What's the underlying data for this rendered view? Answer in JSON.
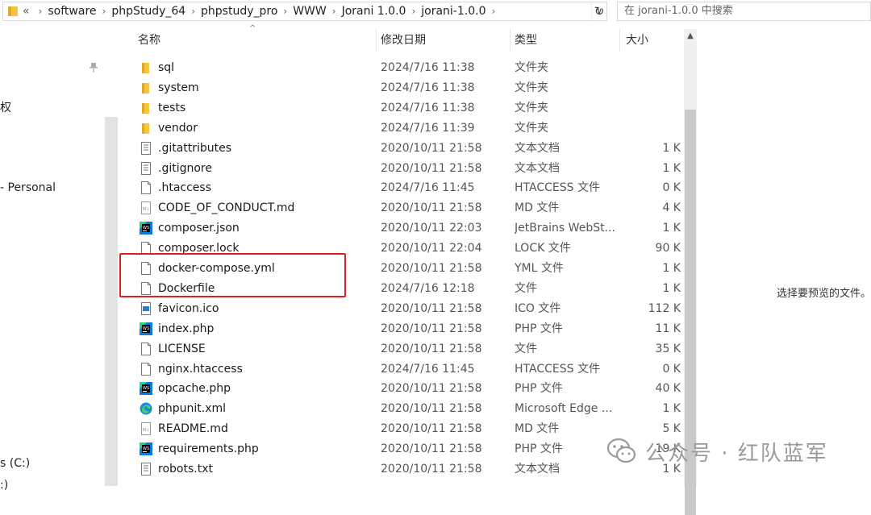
{
  "address": {
    "prefix": "«",
    "crumbs": [
      "software",
      "phpStudy_64",
      "phpstudy_pro",
      "WWW",
      "Jorani 1.0.0",
      "jorani-1.0.0"
    ],
    "separator": "›",
    "dropdown": "∨",
    "refresh": "↻"
  },
  "search": {
    "placeholder": "在 jorani-1.0.0 中搜索"
  },
  "nav": {
    "items": [
      {
        "label": "权"
      },
      {
        "label": "- Personal"
      },
      {
        "label": "s (C:)"
      },
      {
        "label": ":)"
      }
    ],
    "pin": "📌"
  },
  "columns": {
    "name": "名称",
    "date": "修改日期",
    "type": "类型",
    "size": "大小",
    "sort": "^"
  },
  "files": [
    {
      "name": "sql",
      "date": "2024/7/16 11:38",
      "type": "文件夹",
      "size": "",
      "icon": "folder-icon"
    },
    {
      "name": "system",
      "date": "2024/7/16 11:38",
      "type": "文件夹",
      "size": "",
      "icon": "folder-icon"
    },
    {
      "name": "tests",
      "date": "2024/7/16 11:38",
      "type": "文件夹",
      "size": "",
      "icon": "folder-icon"
    },
    {
      "name": "vendor",
      "date": "2024/7/16 11:39",
      "type": "文件夹",
      "size": "",
      "icon": "folder-icon"
    },
    {
      "name": ".gitattributes",
      "date": "2020/10/11 21:58",
      "type": "文本文档",
      "size": "1 K",
      "icon": "text-file-icon"
    },
    {
      "name": ".gitignore",
      "date": "2020/10/11 21:58",
      "type": "文本文档",
      "size": "1 K",
      "icon": "text-file-icon"
    },
    {
      "name": ".htaccess",
      "date": "2024/7/16 11:45",
      "type": "HTACCESS 文件",
      "size": "0 K",
      "icon": "blank-file-icon"
    },
    {
      "name": "CODE_OF_CONDUCT.md",
      "date": "2020/10/11 21:58",
      "type": "MD 文件",
      "size": "4 K",
      "icon": "markdown-file-icon"
    },
    {
      "name": "composer.json",
      "date": "2020/10/11 22:03",
      "type": "JetBrains WebSt...",
      "size": "1 K",
      "icon": "webstorm-icon"
    },
    {
      "name": "composer.lock",
      "date": "2020/10/11 22:04",
      "type": "LOCK 文件",
      "size": "90 K",
      "icon": "blank-file-icon"
    },
    {
      "name": "docker-compose.yml",
      "date": "2020/10/11 21:58",
      "type": "YML 文件",
      "size": "1 K",
      "icon": "blank-file-icon"
    },
    {
      "name": "Dockerfile",
      "date": "2024/7/16 12:18",
      "type": "文件",
      "size": "1 K",
      "icon": "blank-file-icon"
    },
    {
      "name": "favicon.ico",
      "date": "2020/10/11 21:58",
      "type": "ICO 文件",
      "size": "112 K",
      "icon": "image-file-icon"
    },
    {
      "name": "index.php",
      "date": "2020/10/11 21:58",
      "type": "PHP 文件",
      "size": "11 K",
      "icon": "webstorm-icon"
    },
    {
      "name": "LICENSE",
      "date": "2020/10/11 21:58",
      "type": "文件",
      "size": "35 K",
      "icon": "blank-file-icon"
    },
    {
      "name": "nginx.htaccess",
      "date": "2024/7/16 11:45",
      "type": "HTACCESS 文件",
      "size": "0 K",
      "icon": "blank-file-icon"
    },
    {
      "name": "opcache.php",
      "date": "2020/10/11 21:58",
      "type": "PHP 文件",
      "size": "40 K",
      "icon": "webstorm-icon"
    },
    {
      "name": "phpunit.xml",
      "date": "2020/10/11 21:58",
      "type": "Microsoft Edge ...",
      "size": "1 K",
      "icon": "edge-icon"
    },
    {
      "name": "README.md",
      "date": "2020/10/11 21:58",
      "type": "MD 文件",
      "size": "5 K",
      "icon": "markdown-file-icon"
    },
    {
      "name": "requirements.php",
      "date": "2020/10/11 21:58",
      "type": "PHP 文件",
      "size": "19 K",
      "icon": "webstorm-icon"
    },
    {
      "name": "robots.txt",
      "date": "2020/10/11 21:58",
      "type": "文本文档",
      "size": "1 K",
      "icon": "text-file-icon"
    }
  ],
  "preview": {
    "text": "选择要预览的文件。"
  },
  "watermark": {
    "text": "公众号 · 红队蓝军"
  },
  "colors": {
    "highlight": "#e02020",
    "folder": "#f5c542",
    "webstorm": "#0a7bd6"
  }
}
